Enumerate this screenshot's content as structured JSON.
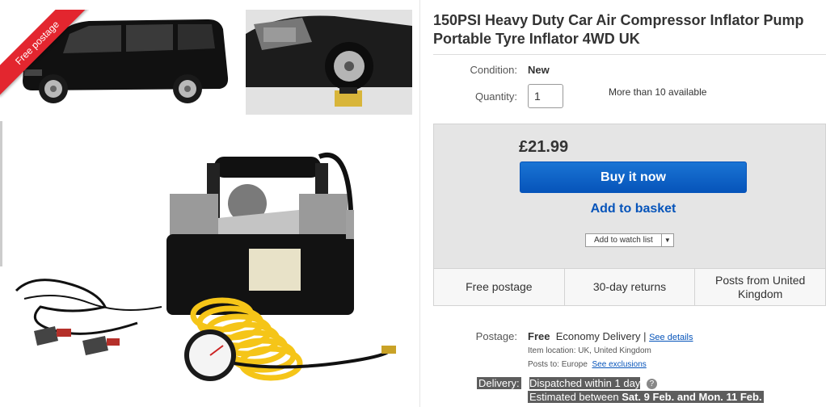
{
  "gallery": {
    "badge": "Free postage"
  },
  "item": {
    "title": "150PSI Heavy Duty Car Air Compressor Inflator Pump Portable Tyre Inflator 4WD UK",
    "condition_label": "Condition:",
    "condition_value": "New",
    "quantity_label": "Quantity:",
    "quantity_value": "1",
    "availability": "More than 10 available"
  },
  "buybox": {
    "price": "£21.99",
    "buy_now": "Buy it now",
    "add_to_basket": "Add to basket",
    "watch_list": "Add to watch list",
    "watch_arrow_icon": "caret-down-icon"
  },
  "perks": [
    "Free postage",
    "30-day returns",
    "Posts from United Kingdom"
  ],
  "postage": {
    "label": "Postage:",
    "cost": "Free",
    "service": "Economy Delivery |",
    "see_details": "See details",
    "location_label": "Item location:",
    "location": "UK, United Kingdom",
    "posts_to_label": "Posts to:",
    "posts_to": "Europe",
    "see_exclusions": "See exclusions"
  },
  "delivery": {
    "label": "Delivery:",
    "dispatch": "Dispatched within 1 day",
    "estimated_prefix": "Estimated between",
    "estimated_range": "Sat. 9 Feb. and Mon. 11 Feb."
  },
  "colors": {
    "accent_blue": "#0654ba",
    "ribbon_red": "#e3262f",
    "buybox_bg": "#e5e5e5"
  }
}
